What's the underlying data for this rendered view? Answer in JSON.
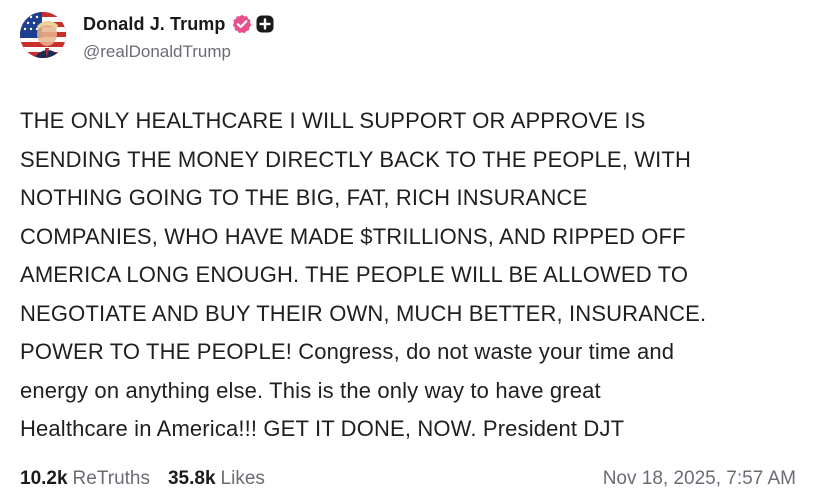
{
  "author": {
    "display_name": "Donald J. Trump",
    "handle": "@realDonaldTrump",
    "verified_icon": "verified-check-icon",
    "plus_icon": "plus-badge-icon",
    "avatar_icon": "avatar-flag-portrait",
    "verified_color": "#e8518b"
  },
  "post": {
    "text": "THE ONLY HEALTHCARE I WILL SUPPORT OR APPROVE IS\nSENDING THE MONEY DIRECTLY BACK TO THE PEOPLE, WITH\nNOTHING GOING TO THE BIG, FAT, RICH INSURANCE\nCOMPANIES, WHO HAVE MADE $TRILLIONS, AND RIPPED OFF\nAMERICA LONG ENOUGH. THE PEOPLE WILL BE ALLOWED TO\nNEGOTIATE AND BUY THEIR OWN, MUCH BETTER, INSURANCE.\nPOWER TO THE PEOPLE! Congress, do not waste your time and\nenergy on anything else. This is the only way to have great\nHealthcare in America!!! GET IT DONE, NOW. President DJT"
  },
  "stats": {
    "retruths_count": "10.2k",
    "retruths_label": "ReTruths",
    "likes_count": "35.8k",
    "likes_label": "Likes"
  },
  "timestamp": "Nov 18, 2025, 7:57 AM"
}
